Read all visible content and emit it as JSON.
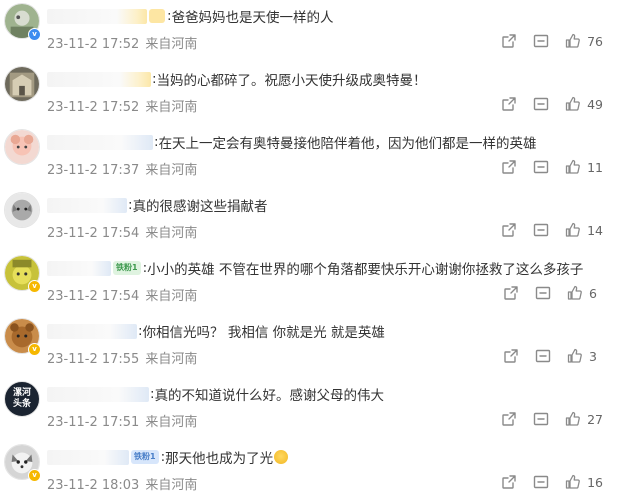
{
  "comments": [
    {
      "text": "爸爸妈妈也是天使一样的人",
      "time": "23-11-2 17:52",
      "location": "来自河南",
      "likes": "76"
    },
    {
      "text": "当妈的心都碎了。祝愿小天使升级成奥特曼！",
      "time": "23-11-2 17:52",
      "location": "来自河南",
      "likes": "49"
    },
    {
      "text": "在天上一定会有奥特曼接他陪伴着他，因为他们都是一样的英雄",
      "time": "23-11-2 17:37",
      "location": "来自河南",
      "likes": "11"
    },
    {
      "text": "真的很感谢这些捐献者",
      "time": "23-11-2 17:54",
      "location": "来自河南",
      "likes": "14"
    },
    {
      "text": "小小的英雄 不管在世界的哪个角落都要快乐开心谢谢你拯救了这么多孩子",
      "time": "23-11-2 17:54",
      "location": "来自河南",
      "likes": "6"
    },
    {
      "text": "你相信光吗？ 我相信 你就是光 就是英雄",
      "time": "23-11-2 17:55",
      "location": "来自河南",
      "likes": "3"
    },
    {
      "text": "真的不知道说什么好。感谢父母的伟大",
      "time": "23-11-2 17:51",
      "location": "来自河南",
      "likes": "27"
    },
    {
      "text": "那天他也成为了光",
      "time": "23-11-2 18:03",
      "location": "来自河南",
      "likes": "16"
    }
  ],
  "badges": {
    "tag_row5": "铁粉1",
    "tag_row8": "铁粉1",
    "avatar_row7": "漯河\n头条"
  },
  "colors": {
    "like": "#666666",
    "meta": "#8a8a8a",
    "text": "#333333",
    "verified": "#f6b800"
  },
  "icons": [
    "share-icon",
    "comment-icon",
    "like-icon"
  ]
}
